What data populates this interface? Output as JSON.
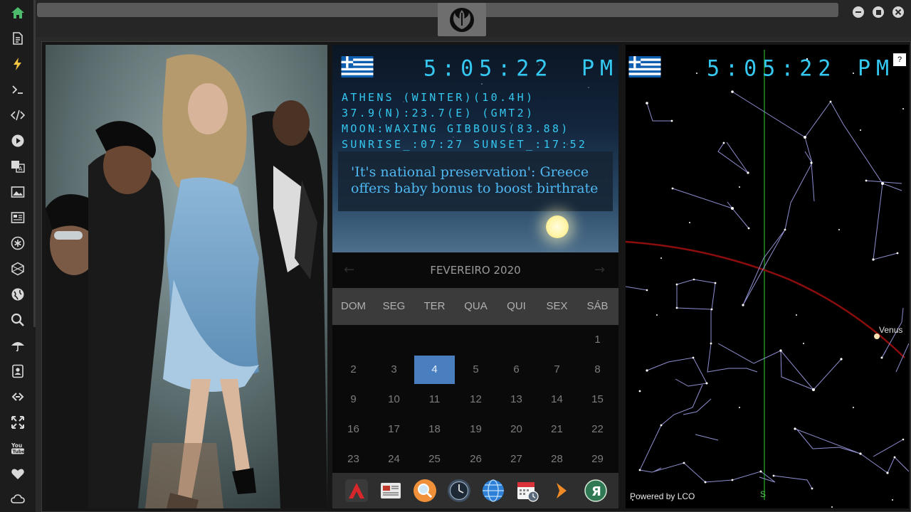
{
  "sidebar": {
    "icons": [
      "home-icon",
      "document-icon",
      "lightning-icon",
      "terminal-icon",
      "code-icon",
      "play-icon",
      "translate-icon",
      "image-icon",
      "news-icon",
      "asterisk-icon",
      "hexagon-icon",
      "globe-icon",
      "search-icon",
      "umbrella-icon",
      "contact-icon",
      "link-icon",
      "expand-icon",
      "youtube-icon",
      "heart-icon",
      "cloud-icon"
    ],
    "accent_home": "#4cbb6c",
    "accent_bolt": "#f5c542"
  },
  "clock": {
    "time": "5:05:22",
    "ampm": "PM",
    "line1": "ATHENS (WINTER)(10.4H)",
    "line2": "37.9(N):23.7(E) (GMT2)",
    "line3": "MOON:WAXING GIBBOUS(83.88)",
    "line4": "SUNRISE_:07:27 SUNSET_:17:52",
    "headline": "'It's national preservation': Greece offers baby bonus to boost birthrate",
    "digital_color": "#35c8f0"
  },
  "calendar": {
    "month_label": "FEVEREIRO 2020",
    "prev": "←",
    "next": "→",
    "weekdays": [
      "DOM",
      "SEG",
      "TER",
      "QUA",
      "QUI",
      "SEX",
      "SÁB"
    ],
    "weeks": [
      [
        "",
        "",
        "",
        "",
        "",
        "",
        "1"
      ],
      [
        "2",
        "3",
        "4",
        "5",
        "6",
        "7",
        "8"
      ],
      [
        "9",
        "10",
        "11",
        "12",
        "13",
        "14",
        "15"
      ],
      [
        "16",
        "17",
        "18",
        "19",
        "20",
        "21",
        "22"
      ],
      [
        "23",
        "24",
        "25",
        "26",
        "27",
        "28",
        "29"
      ]
    ],
    "today": "4",
    "today_color": "#4a7fbf"
  },
  "dock": {
    "icons": [
      "red-a-app-icon",
      "news-app-icon",
      "search-app-icon",
      "clock-app-icon",
      "globe-app-icon",
      "calendar-app-icon",
      "arrow-app-icon",
      "yandex-app-icon"
    ]
  },
  "skymap": {
    "time": "5:05:22",
    "ampm": "PM",
    "help": "?",
    "powered": "Powered by LCO",
    "venus": "Venus",
    "south": "S"
  }
}
